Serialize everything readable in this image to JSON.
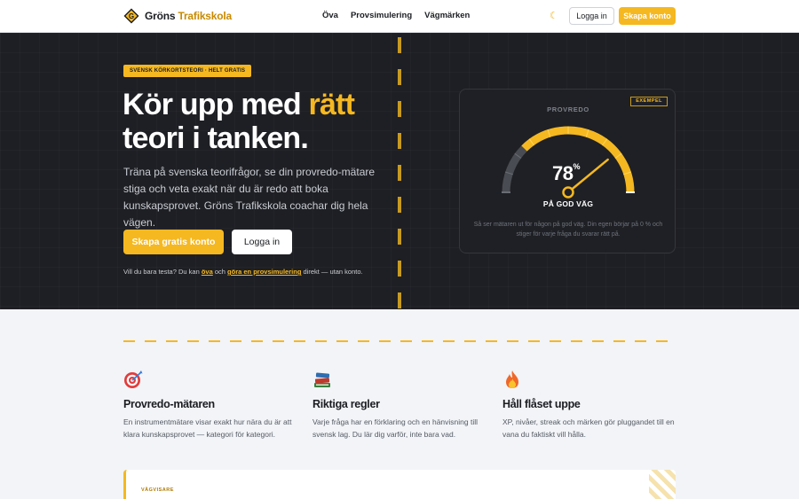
{
  "nav": {
    "logo_letter": "G",
    "logo_text_main": "Gröns",
    "logo_text_accent": "Trafikskola",
    "links": [
      "Öva",
      "Provsimulering",
      "Vägmärken"
    ],
    "theme_icon": "moon-icon",
    "login_label": "Logga in",
    "create_label": "Skapa konto"
  },
  "hero": {
    "badge": "SVENSK KÖRKORTSTEORI · HELT GRATIS",
    "title_before": "Kör upp med ",
    "title_highlight": "rätt",
    "title_after": " teori i tanken.",
    "description": "Träna på svenska teorifrågor, se din provredo-mätare stiga och veta exakt när du är redo att boka kunskapsprovet. Gröns Trafikskola coachar dig hela vägen.",
    "primary_button": "Skapa gratis konto",
    "secondary_button": "Logga in",
    "note_prefix": "Vill du bara testa? Du kan ",
    "note_link1": "öva",
    "note_middle": " och ",
    "note_link2": "göra en provsimulering",
    "note_suffix": " direkt — utan konto."
  },
  "gauge": {
    "tag": "EXEMPEL",
    "label": "PROVREDO",
    "value": 78,
    "value_text": "78",
    "unit": "%",
    "status": "PÅ GOD VÄG",
    "caption": "Så ser mätaren ut för någon på god väg. Din egen börjar på 0 % och stiger för varje fråga du svarar rätt på.",
    "colors": {
      "fill": "#f5b820",
      "track": "#4a4c53",
      "needle": "#f5b820"
    }
  },
  "features": [
    {
      "icon": "target-icon",
      "title": "Provredo-mätaren",
      "text": "En instrumentmätare visar exakt hur nära du är att klara kunskapsprovet — kategori för kategori."
    },
    {
      "icon": "books-icon",
      "title": "Riktiga regler",
      "text": "Varje fråga har en förklaring och en hänvisning till svensk lag. Du lär dig varför, inte bara vad."
    },
    {
      "icon": "fire-icon",
      "title": "Håll flåset uppe",
      "text": "XP, nivåer, streak och märken gör pluggandet till en vana du faktiskt vill hålla."
    }
  ],
  "guide": {
    "tag": "VÄGVISARE"
  },
  "colors": {
    "accent": "#f5b820",
    "dark": "#1e1f24",
    "light_bg": "#f2f4f7"
  }
}
